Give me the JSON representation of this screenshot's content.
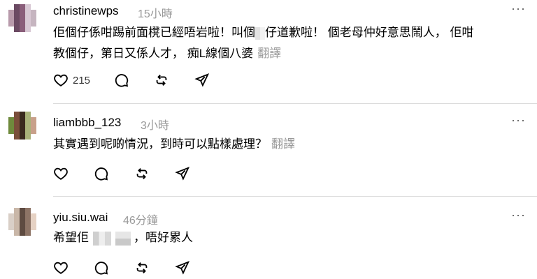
{
  "comments": [
    {
      "username": "christinewps",
      "time": "15小時",
      "line1_a": "佢個仔係咁踢前面櫈已經唔岩啦！叫個",
      "line1_b": "仔道歉啦！ 個老母仲好意思鬧人， 佢咁",
      "line2": "教個仔，第日又係人才， 痴L線個八婆",
      "translate": "翻譯",
      "like_count": "215",
      "avatar_palette": [
        "#b89aab",
        "#8a5e7a",
        "#c6b5c0",
        "#6b4a63",
        "#d8c8d4"
      ]
    },
    {
      "username": "liambbb_123",
      "time": "3小時",
      "line1": "其實遇到呢啲情況，到時可以點樣處理？",
      "translate": "翻譯",
      "avatar_palette": [
        "#a9b27a",
        "#6f8a3c",
        "#3a2a1e",
        "#c8a08a",
        "#7a4e3a"
      ]
    },
    {
      "username": "yiu.siu.wai",
      "time": "46分鐘",
      "line1_a": "希望佢",
      "line1_b": "，唔好累人",
      "avatar_palette": [
        "#c9b7a8",
        "#8d7466",
        "#d9cfc7",
        "#5e4b41",
        "#e6d2c4"
      ]
    }
  ],
  "more_label": "···",
  "icons": [
    "heart-icon",
    "comment-icon",
    "repost-icon",
    "share-icon",
    "more-icon"
  ],
  "colors": {
    "divider": "#dbdbdb",
    "muted": "#999999"
  }
}
